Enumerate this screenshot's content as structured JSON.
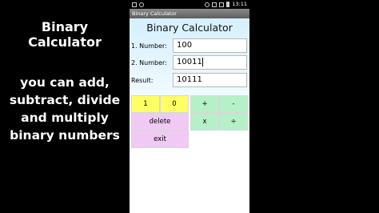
{
  "captions": {
    "title": "Binary Calculator",
    "body": "you can add, subtract, divide and multiply binary numbers"
  },
  "statusbar": {
    "time": "13:11"
  },
  "titlebar": {
    "label": "Binary Calculator"
  },
  "app": {
    "title": "Binary Calculator",
    "number1_label": "1. Number:",
    "number1_value": "100",
    "number2_label": "2. Number:",
    "number2_value": "10011",
    "result_label": "Result:",
    "result_value": "10111"
  },
  "buttons": {
    "one": "1",
    "zero": "0",
    "plus": "+",
    "minus": "-",
    "delete": "delete",
    "multiply": "x",
    "divide": "÷",
    "exit": "exit"
  },
  "colors": {
    "digit_buttons": "#ffff66",
    "action_buttons": "#f1c9f5",
    "operator_buttons": "#b5f0c9"
  }
}
